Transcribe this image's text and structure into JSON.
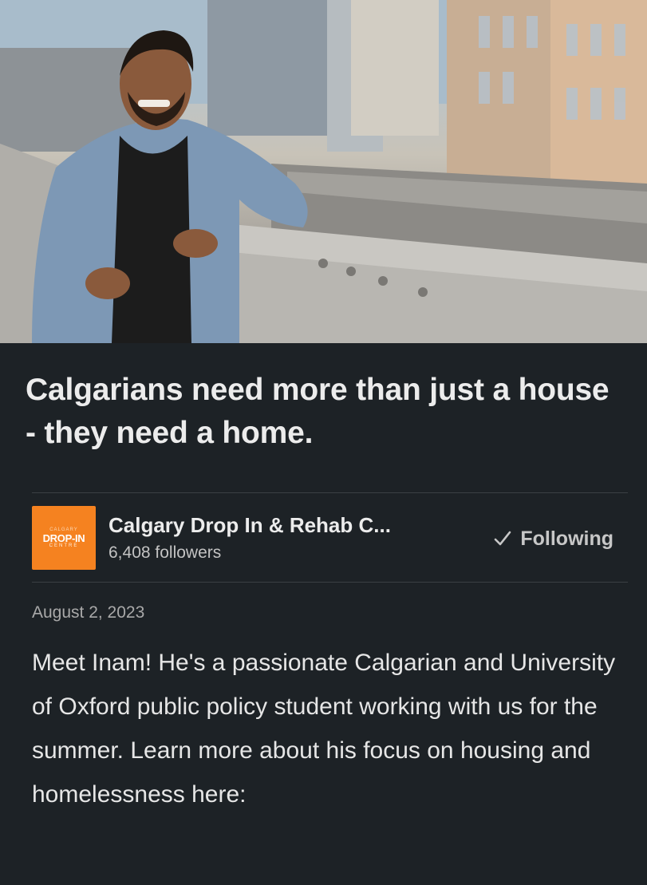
{
  "article": {
    "title": "Calgarians need more than just a house - they need a home.",
    "date": "August 2, 2023",
    "body": "Meet Inam! He's a passionate Calgarian and University of Oxford public policy student working with us for the summer. Learn more about his focus on housing and homelessness here:"
  },
  "org": {
    "logo_top": "CALGARY",
    "logo_main": "DROP-IN",
    "logo_bottom": "CENTRE",
    "name": "Calgary Drop In & Rehab C...",
    "followers": "6,408 followers",
    "follow_label": "Following",
    "follow_icon": "check-icon"
  },
  "colors": {
    "background": "#1d2226",
    "logo": "#f58220"
  }
}
